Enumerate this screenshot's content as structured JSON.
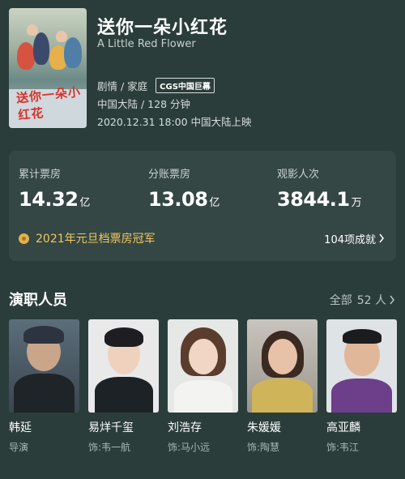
{
  "movie": {
    "title": "送你一朵小红花",
    "original_title": "A Little Red Flower",
    "poster_title": "送你一朵小红花",
    "genres": "剧情 / 家庭",
    "format_badge": "CGS中国巨幕",
    "region_runtime": "中国大陆 / 128 分钟",
    "release": "2020.12.31 18:00 中国大陆上映"
  },
  "box_office": {
    "stats": [
      {
        "label": "累计票房",
        "value": "14.32",
        "unit": "亿"
      },
      {
        "label": "分账票房",
        "value": "13.08",
        "unit": "亿"
      },
      {
        "label": "观影人次",
        "value": "3844.1",
        "unit": "万"
      }
    ],
    "award": "2021年元旦档票房冠军",
    "awards_count": "104项成就"
  },
  "cast": {
    "title": "演职人员",
    "all_label": "全部",
    "count_label": "52 人",
    "members": [
      {
        "name": "韩延",
        "role": "导演"
      },
      {
        "name": "易烊千玺",
        "role": "饰:韦一航"
      },
      {
        "name": "刘浩存",
        "role": "饰:马小远"
      },
      {
        "name": "朱媛媛",
        "role": "饰:陶慧"
      },
      {
        "name": "高亚麟",
        "role": "饰:韦江"
      }
    ]
  },
  "colors": {
    "background": "#2a3d3a",
    "card": "#344744",
    "award_gold": "#f1c760"
  }
}
